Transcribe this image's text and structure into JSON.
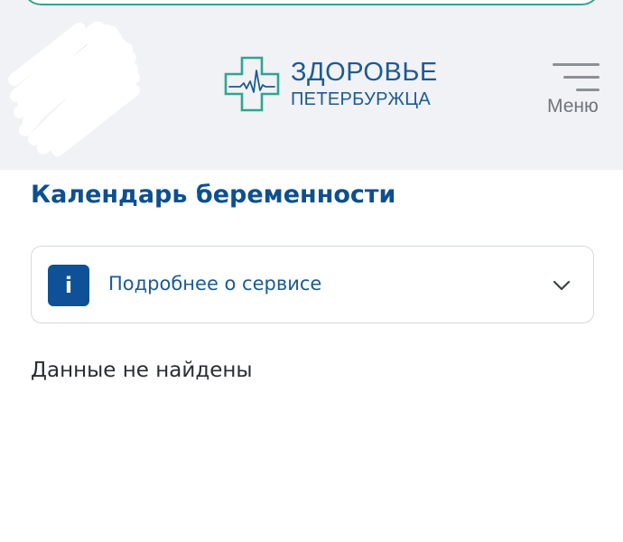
{
  "header": {
    "logo": {
      "line1": "ЗДОРОВЬЕ",
      "line2": "ПЕТЕРБУРЖЦА",
      "color": "#1d5a95",
      "cross_color": "#2fa58f"
    },
    "avatar_icon": "user-avatar-icon",
    "menu": {
      "icon": "hamburger-icon",
      "label": "Меню"
    }
  },
  "main": {
    "title": "Календарь беременности",
    "accordion": {
      "icon_glyph": "i",
      "icon": "info-icon",
      "label": "Подробнее о сервисе",
      "toggle_icon": "chevron-down-icon",
      "expanded": false
    },
    "empty_message": "Данные не найдены"
  },
  "colors": {
    "primary": "#0d4f8f",
    "accent": "#2fa58f",
    "header_bg": "#f0f2f5"
  }
}
